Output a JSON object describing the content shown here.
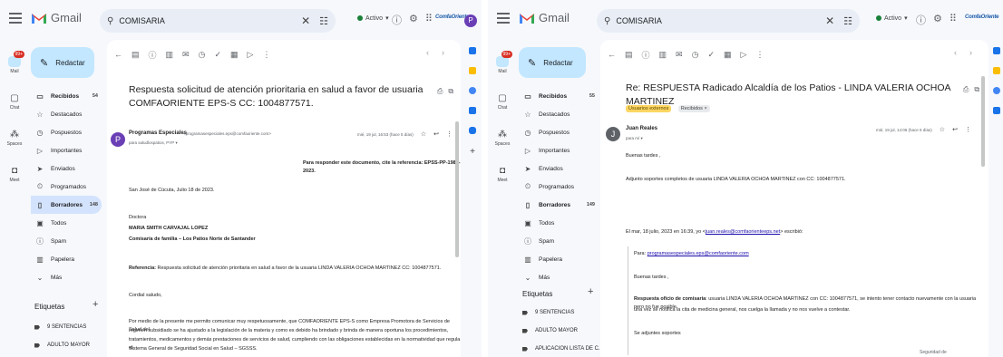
{
  "app": {
    "name": "Gmail"
  },
  "colors": {
    "accent": "#c2e7ff",
    "active_nav": "#d3e3fd",
    "avatar": "#6a3fb5",
    "status_green": "#188038",
    "brand_blue": "#1a5aa8"
  },
  "left": {
    "search": {
      "query": "COMISARIA"
    },
    "status": "Activo",
    "brand": "ComfaOriente",
    "avatar_letter": "P",
    "rail": [
      {
        "label": "Mail",
        "icon": "mail-icon",
        "badge": "99+"
      },
      {
        "label": "Chat",
        "icon": "chat-icon"
      },
      {
        "label": "Spaces",
        "icon": "spaces-icon"
      },
      {
        "label": "Meet",
        "icon": "meet-icon"
      }
    ],
    "compose": "Redactar",
    "nav": [
      {
        "label": "Recibidos",
        "count": "54",
        "icon": "inbox-icon",
        "bold": true
      },
      {
        "label": "Destacados",
        "count": "",
        "icon": "star-icon"
      },
      {
        "label": "Pospuestos",
        "count": "",
        "icon": "clock-icon"
      },
      {
        "label": "Importantes",
        "count": "",
        "icon": "important-icon"
      },
      {
        "label": "Enviados",
        "count": "",
        "icon": "send-icon"
      },
      {
        "label": "Programados",
        "count": "",
        "icon": "scheduled-icon"
      },
      {
        "label": "Borradores",
        "count": "148",
        "icon": "draft-icon",
        "bold": true
      },
      {
        "label": "Todos",
        "count": "",
        "icon": "all-mail-icon"
      },
      {
        "label": "Spam",
        "count": "",
        "icon": "spam-icon"
      },
      {
        "label": "Papelera",
        "count": "",
        "icon": "trash-icon"
      },
      {
        "label": "Más",
        "count": "",
        "icon": "chevron-down-icon"
      }
    ],
    "labels_header": "Etiquetas",
    "labels": [
      "9 SENTENCIAS",
      "ADULTO MAYOR"
    ],
    "email": {
      "subject": "Respuesta solicitud de atención prioritaria en salud a favor de usuaria COMFAORIENTE EPS-S CC: 1004877571.",
      "sender_name": "Programas Especiales",
      "sender_email": "<programasespeciales.eps@comfaoriente.com>",
      "to": "para saludlospatios, PYP ▾",
      "date": "mié, 19 jul, 16:53 (hace 5 días)",
      "reference_line": "Para responder este documento, cite la referencia: EPSS-PP-1983-2023.",
      "place_date": "San José de Cúcuta, Julio 18 de 2023.",
      "salutation1": "Doctora",
      "recipient_name": "MARIA SMITH CARVAJAL LOPEZ",
      "recipient_org": "Comisaría de familia – Los Patios Norte de Santander",
      "referencia_label": "Referencia:",
      "referencia_text": "Respuesta solicitud de atención prioritaria en salud a favor de la usuaria LINDA VALERIA OCHOA MARTINEZ CC: 1004877571.",
      "greeting": "Cordial saludo,",
      "para1_l1": "Por medio de la presente me permito comunicar muy respetuosamente, que COMFAORIENTE EPS-S como Empresa Promotora de Servicios de Salud del",
      "para1_l2": "régimen subsidiado se ha ajustado a la legislación de la materia y como es debido ha brindado y brinda de manera oportuna los procedimientos,",
      "para1_l3": "tratamientos, medicamentos y demás prestaciones de servicios de salud, cumpliendo con las obligaciones establecidas en la normatividad que regula el",
      "para1_l4": "Sistema General de Seguridad Social en Salud – SGSSS."
    }
  },
  "right": {
    "search": {
      "query": "COMISARIA"
    },
    "status": "Activo",
    "brand": "ComfaOriente",
    "rail": [
      {
        "label": "Mail",
        "icon": "mail-icon",
        "badge": "99+"
      },
      {
        "label": "Chat",
        "icon": "chat-icon"
      },
      {
        "label": "Spaces",
        "icon": "spaces-icon"
      },
      {
        "label": "Meet",
        "icon": "meet-icon"
      }
    ],
    "compose": "Redactar",
    "nav": [
      {
        "label": "Recibidos",
        "count": "55",
        "icon": "inbox-icon",
        "bold": true
      },
      {
        "label": "Destacados",
        "count": "",
        "icon": "star-icon"
      },
      {
        "label": "Pospuestos",
        "count": "",
        "icon": "clock-icon"
      },
      {
        "label": "Importantes",
        "count": "",
        "icon": "important-icon"
      },
      {
        "label": "Enviados",
        "count": "",
        "icon": "send-icon"
      },
      {
        "label": "Programados",
        "count": "",
        "icon": "scheduled-icon"
      },
      {
        "label": "Borradores",
        "count": "149",
        "icon": "draft-icon",
        "bold": true
      },
      {
        "label": "Todos",
        "count": "",
        "icon": "all-mail-icon"
      },
      {
        "label": "Spam",
        "count": "",
        "icon": "spam-icon"
      },
      {
        "label": "Papelera",
        "count": "",
        "icon": "trash-icon"
      },
      {
        "label": "Más",
        "count": "",
        "icon": "chevron-down-icon"
      }
    ],
    "labels_header": "Etiquetas",
    "labels": [
      "9 SENTENCIAS",
      "ADULTO MAYOR",
      "APLICACION LISTA DE C..."
    ],
    "email": {
      "subject": "Re: RESPUESTA Radicado Alcaldía de los Patios - LINDA VALERIA OCHOA MARTINEZ",
      "chip1": "Usuarios externos",
      "chip2": "Recibidos ×",
      "sender_name": "Juan Reales",
      "avatar_letter": "J",
      "to": "para mí ▾",
      "date": "mié, 19 jul, 14:06 (hace 5 días)",
      "l1": "Buenas tardes ,",
      "l2": "Adjunto soportes completos de usuaria LINDA VALERIA OCHOA MARTINEZ con CC: 1004877571.",
      "quote_header_prefix": "El mar, 18 julio, 2023 en 16:39, yo <",
      "quote_header_link": "juan.reales@comfaorienteeps.net",
      "quote_header_suffix": "> escribió:",
      "quote_para": "Para:",
      "quote_to_link": "programasespeciales.eps@comfaoriente.com",
      "quote_greet": "Buenas tardes ,",
      "quote_resp_label": "Respuesta oficio de comisaria",
      "quote_resp_text": ": usuaria LINDA VALERIA OCHOA MARTINEZ con CC: 1004877571, se intento tener contacto nuevamente con la usuaria pero no fue posible,",
      "quote_resp_l2": "una vez se notifica la cita de medicina general, nos cuelga la llamada y no nos vuelve a contestar.",
      "quote_attach": "Se adjuntes soportes",
      "footer": "Seguridad de"
    }
  }
}
